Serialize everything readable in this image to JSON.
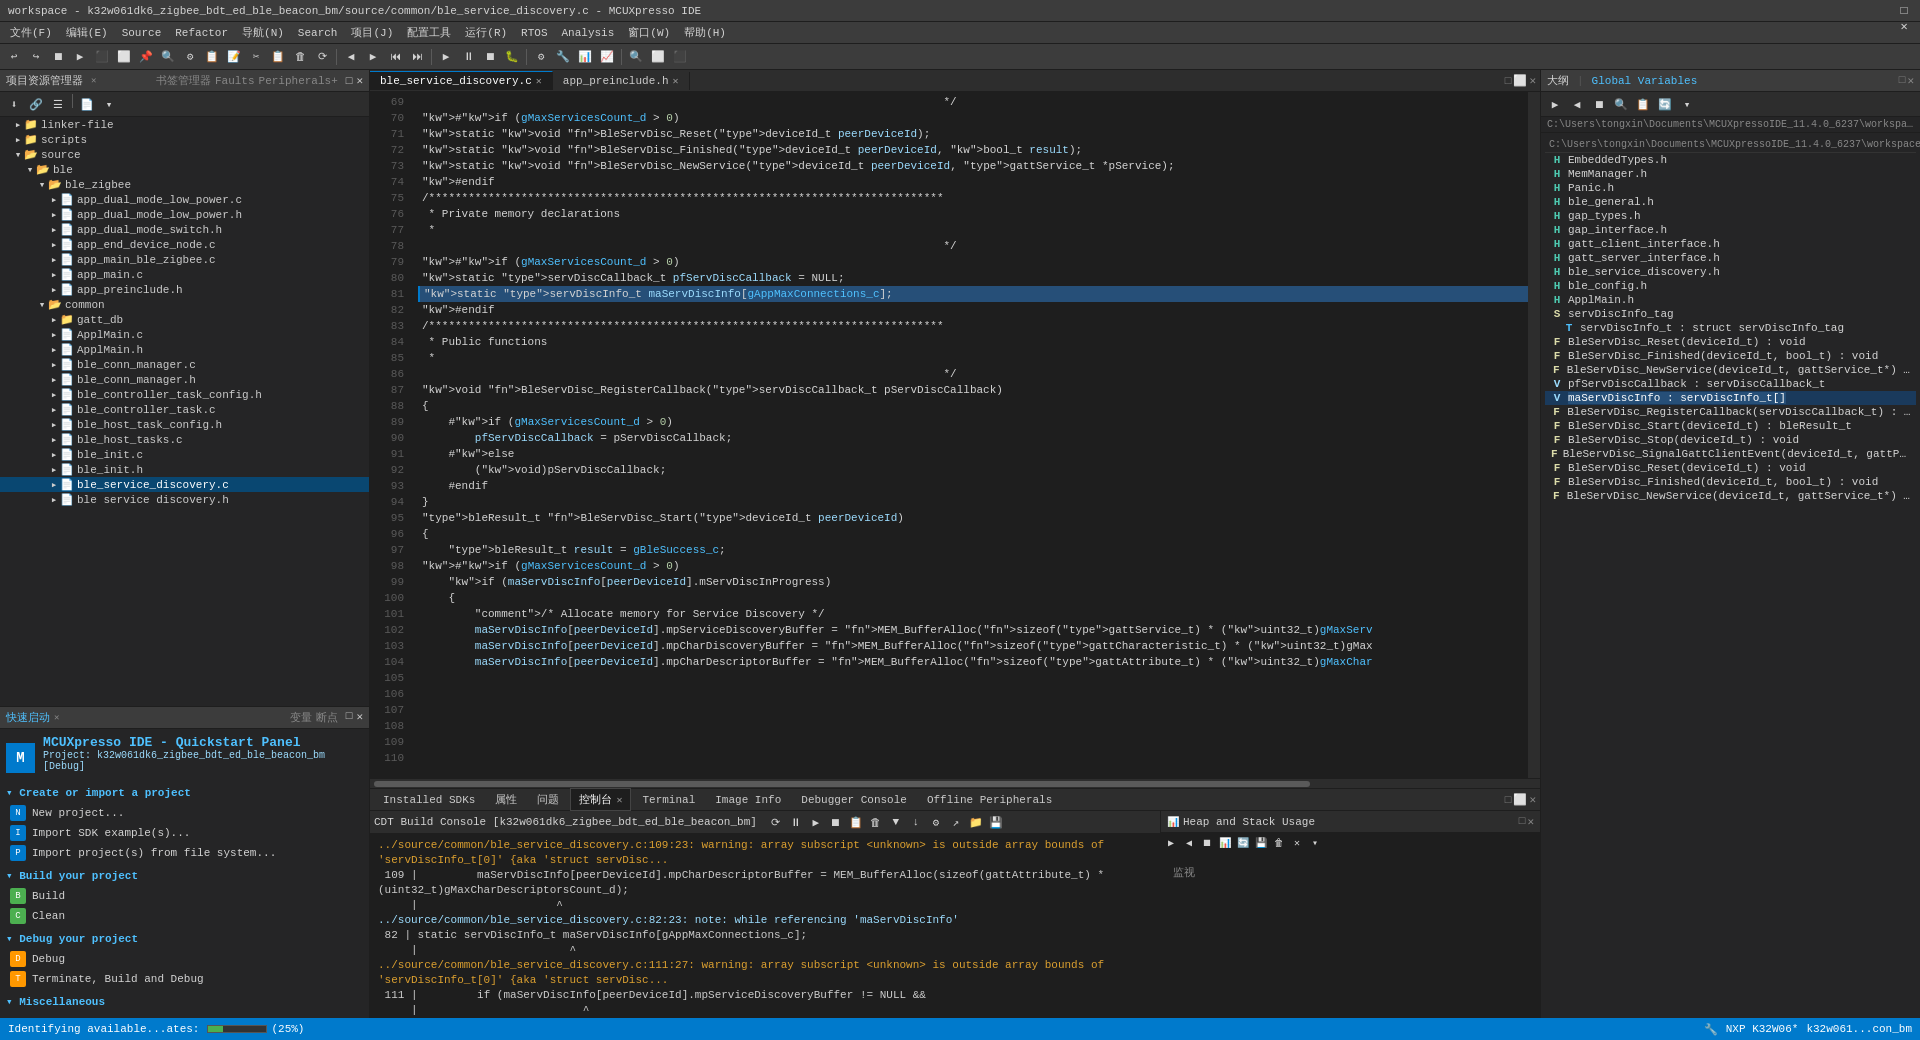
{
  "titleBar": {
    "title": "workspace - k32w061dk6_zigbee_bdt_ed_ble_beacon_bm/source/common/ble_service_discovery.c - MCUXpresso IDE",
    "minimize": "─",
    "maximize": "□",
    "close": "✕"
  },
  "menuBar": {
    "items": [
      "文件(F)",
      "编辑(E)",
      "Source",
      "Refactor",
      "导航(N)",
      "Search",
      "项目(J)",
      "配置工具",
      "运行(R)",
      "RTOS",
      "Analysis",
      "窗口(W)",
      "帮助(H)"
    ]
  },
  "leftPanel": {
    "title": "项目资源管理器",
    "tabs": [
      "书签管理器",
      "Faults",
      "Peripherals+"
    ],
    "tree": [
      {
        "label": "linker-file",
        "indent": 1,
        "expanded": false,
        "icon": "📁"
      },
      {
        "label": "scripts",
        "indent": 1,
        "expanded": false,
        "icon": "📁"
      },
      {
        "label": "source",
        "indent": 1,
        "expanded": true,
        "icon": "📂"
      },
      {
        "label": "ble",
        "indent": 2,
        "expanded": true,
        "icon": "📂"
      },
      {
        "label": "ble_zigbee",
        "indent": 3,
        "expanded": true,
        "icon": "📂"
      },
      {
        "label": "app_dual_mode_low_power.c",
        "indent": 4,
        "expanded": false,
        "icon": "📄"
      },
      {
        "label": "app_dual_mode_low_power.h",
        "indent": 4,
        "expanded": false,
        "icon": "📄"
      },
      {
        "label": "app_dual_mode_switch.h",
        "indent": 4,
        "expanded": false,
        "icon": "📄"
      },
      {
        "label": "app_end_device_node.c",
        "indent": 4,
        "expanded": false,
        "icon": "📄"
      },
      {
        "label": "app_main_ble_zigbee.c",
        "indent": 4,
        "expanded": false,
        "icon": "📄"
      },
      {
        "label": "app_main.c",
        "indent": 4,
        "expanded": false,
        "icon": "📄"
      },
      {
        "label": "app_preinclude.h",
        "indent": 4,
        "expanded": false,
        "icon": "📄"
      },
      {
        "label": "common",
        "indent": 3,
        "expanded": true,
        "icon": "📂"
      },
      {
        "label": "gatt_db",
        "indent": 4,
        "expanded": false,
        "icon": "📁"
      },
      {
        "label": "ApplMain.c",
        "indent": 4,
        "expanded": false,
        "icon": "📄"
      },
      {
        "label": "ApplMain.h",
        "indent": 4,
        "expanded": false,
        "icon": "📄"
      },
      {
        "label": "ble_conn_manager.c",
        "indent": 4,
        "expanded": false,
        "icon": "📄"
      },
      {
        "label": "ble_conn_manager.h",
        "indent": 4,
        "expanded": false,
        "icon": "📄"
      },
      {
        "label": "ble_controller_task_config.h",
        "indent": 4,
        "expanded": false,
        "icon": "📄"
      },
      {
        "label": "ble_controller_task.c",
        "indent": 4,
        "expanded": false,
        "icon": "📄"
      },
      {
        "label": "ble_host_task_config.h",
        "indent": 4,
        "expanded": false,
        "icon": "📄"
      },
      {
        "label": "ble_host_tasks.c",
        "indent": 4,
        "expanded": false,
        "icon": "📄"
      },
      {
        "label": "ble_init.c",
        "indent": 4,
        "expanded": false,
        "icon": "📄"
      },
      {
        "label": "ble_init.h",
        "indent": 4,
        "expanded": false,
        "icon": "📄"
      },
      {
        "label": "ble_service_discovery.c",
        "indent": 4,
        "expanded": false,
        "icon": "📄",
        "selected": true
      },
      {
        "label": "ble service discovery.h",
        "indent": 4,
        "expanded": false,
        "icon": "📄"
      }
    ]
  },
  "quickstartPanel": {
    "header": "快速启动",
    "tabs": [
      "变量",
      "断点"
    ],
    "logoText": "MCUXpresso IDE - Quickstart Panel",
    "projectLabel": "Project: k32w061dk6_zigbee_bdt_ed_ble_beacon_bm [Debug]",
    "sections": [
      {
        "title": "Create or import a project",
        "items": [
          {
            "icon": "N",
            "label": "New project..."
          },
          {
            "icon": "I",
            "label": "Import SDK example(s)..."
          },
          {
            "icon": "P",
            "label": "Import project(s) from file system..."
          }
        ]
      },
      {
        "title": "Build your project",
        "items": [
          {
            "icon": "B",
            "label": "Build"
          },
          {
            "icon": "C",
            "label": "Clean"
          }
        ]
      },
      {
        "title": "Debug your project",
        "items": [
          {
            "icon": "D",
            "label": "Debug"
          },
          {
            "icon": "T",
            "label": "Terminate, Build and Debug"
          }
        ]
      }
    ],
    "miscellaneous": "Miscellaneous"
  },
  "editorTabs": [
    {
      "label": "ble_service_discovery.c",
      "active": true,
      "modified": false
    },
    {
      "label": "app_preinclude.h",
      "active": false,
      "modified": false
    }
  ],
  "editorToolbar": {
    "buttons": [
      "◀",
      "▶",
      "⟳",
      "✕"
    ]
  },
  "codeLines": [
    {
      "num": 69,
      "text": "                                                                               */"
    },
    {
      "num": 70,
      "text": "#if (gMaxServicesCount_d > 0)"
    },
    {
      "num": 71,
      "text": "static void BleServDisc_Reset(deviceId_t peerDeviceId);"
    },
    {
      "num": 72,
      "text": "static void BleServDisc_Finished(deviceId_t peerDeviceId, bool_t result);"
    },
    {
      "num": 73,
      "text": "static void BleServDisc_NewService(deviceId_t peerDeviceId, gattService_t *pService);"
    },
    {
      "num": 74,
      "text": "#endif"
    },
    {
      "num": 75,
      "text": "/******************************************************************************"
    },
    {
      "num": 76,
      "text": ""
    },
    {
      "num": 77,
      "text": " * Private memory declarations"
    },
    {
      "num": 78,
      "text": " *"
    },
    {
      "num": 79,
      "text": "                                                                               */"
    },
    {
      "num": 80,
      "text": "#if (gMaxServicesCount_d > 0)"
    },
    {
      "num": 81,
      "text": "static servDiscCallback_t pfServDiscCallback = NULL;"
    },
    {
      "num": 82,
      "text": "static servDiscInfo_t maServDiscInfo[gAppMaxConnections_c];",
      "selected": true
    },
    {
      "num": 83,
      "text": "#endif"
    },
    {
      "num": 84,
      "text": "/******************************************************************************"
    },
    {
      "num": 85,
      "text": ""
    },
    {
      "num": 86,
      "text": " * Public functions"
    },
    {
      "num": 87,
      "text": " *"
    },
    {
      "num": 88,
      "text": "                                                                               */"
    },
    {
      "num": 89,
      "text": ""
    },
    {
      "num": 90,
      "text": "void BleServDisc_RegisterCallback(servDiscCallback_t pServDiscCallback)"
    },
    {
      "num": 91,
      "text": "{"
    },
    {
      "num": 92,
      "text": "    #if (gMaxServicesCount_d > 0)"
    },
    {
      "num": 93,
      "text": "        pfServDiscCallback = pServDiscCallback;"
    },
    {
      "num": 94,
      "text": "    #else"
    },
    {
      "num": 95,
      "text": "        (void)pServDiscCallback;"
    },
    {
      "num": 96,
      "text": "    #endif"
    },
    {
      "num": 97,
      "text": "}"
    },
    {
      "num": 98,
      "text": ""
    },
    {
      "num": 99,
      "text": "bleResult_t BleServDisc_Start(deviceId_t peerDeviceId)"
    },
    {
      "num": 100,
      "text": "{"
    },
    {
      "num": 101,
      "text": "    bleResult_t result = gBleSuccess_c;"
    },
    {
      "num": 102,
      "text": ""
    },
    {
      "num": 103,
      "text": "#if (gMaxServicesCount_d > 0)"
    },
    {
      "num": 104,
      "text": "    if (maServDiscInfo[peerDeviceId].mServDiscInProgress)"
    },
    {
      "num": 105,
      "text": "    {"
    },
    {
      "num": 106,
      "text": "        /* Allocate memory for Service Discovery */"
    },
    {
      "num": 107,
      "text": ""
    },
    {
      "num": 108,
      "text": "        maServDiscInfo[peerDeviceId].mpServiceDiscoveryBuffer = MEM_BufferAlloc(sizeof(gattService_t) * (uint32_t)gMaxServ"
    },
    {
      "num": 109,
      "text": "        maServDiscInfo[peerDeviceId].mpCharDiscoveryBuffer = MEM_BufferAlloc(sizeof(gattCharacteristic_t) * (uint32_t)gMax"
    },
    {
      "num": 110,
      "text": "        maServDiscInfo[peerDeviceId].mpCharDescriptorBuffer = MEM_BufferAlloc(sizeof(gattAttribute_t) * (uint32_t)gMaxChar"
    }
  ],
  "rightPanel": {
    "title": "大纲",
    "tabs": [
      "Global Variables"
    ],
    "path": "C:\\Users\\tongxin\\Documents\\MCUXpressoIDE_11.4.0_6237\\workspace\\k32w06...",
    "items": [
      {
        "label": "EmbeddedTypes.h",
        "indent": 0,
        "icon": "H"
      },
      {
        "label": "MemManager.h",
        "indent": 0,
        "icon": "H"
      },
      {
        "label": "Panic.h",
        "indent": 0,
        "icon": "H"
      },
      {
        "label": "ble_general.h",
        "indent": 0,
        "icon": "H"
      },
      {
        "label": "gap_types.h",
        "indent": 0,
        "icon": "H"
      },
      {
        "label": "gap_interface.h",
        "indent": 0,
        "icon": "H"
      },
      {
        "label": "gatt_client_interface.h",
        "indent": 0,
        "icon": "H"
      },
      {
        "label": "gatt_server_interface.h",
        "indent": 0,
        "icon": "H"
      },
      {
        "label": "ble_service_discovery.h",
        "indent": 0,
        "icon": "H"
      },
      {
        "label": "ble_config.h",
        "indent": 0,
        "icon": "H"
      },
      {
        "label": "ApplMain.h",
        "indent": 0,
        "icon": "H"
      },
      {
        "label": "servDiscInfo_tag",
        "indent": 0,
        "icon": "S",
        "expanded": true
      },
      {
        "label": "servDiscInfo_t : struct servDiscInfo_tag",
        "indent": 1,
        "icon": "T"
      },
      {
        "label": "BleServDisc_Reset(deviceId_t) : void",
        "indent": 0,
        "icon": "F"
      },
      {
        "label": "BleServDisc_Finished(deviceId_t, bool_t) : void",
        "indent": 0,
        "icon": "F"
      },
      {
        "label": "BleServDisc_NewService(deviceId_t, gattService_t*) : void",
        "indent": 0,
        "icon": "F"
      },
      {
        "label": "pfServDiscCallback : servDiscCallback_t",
        "indent": 0,
        "icon": "V"
      },
      {
        "label": "maServDiscInfo : servDiscInfo_t[]",
        "indent": 0,
        "icon": "V",
        "selected": true,
        "highlighted": true
      },
      {
        "label": "BleServDisc_RegisterCallback(servDiscCallback_t) : void",
        "indent": 0,
        "icon": "F"
      },
      {
        "label": "BleServDisc_Start(deviceId_t) : bleResult_t",
        "indent": 0,
        "icon": "F"
      },
      {
        "label": "BleServDisc_Stop(deviceId_t) : void",
        "indent": 0,
        "icon": "F"
      },
      {
        "label": "BleServDisc_SignalGattClientEvent(deviceId_t, gattProcedureType_t, gattProce...",
        "indent": 0,
        "icon": "F"
      },
      {
        "label": "BleServDisc_Reset(deviceId_t) : void",
        "indent": 0,
        "icon": "F"
      },
      {
        "label": "BleServDisc_Finished(deviceId_t, bool_t) : void",
        "indent": 0,
        "icon": "F"
      },
      {
        "label": "BleServDisc_NewService(deviceId_t, gattService_t*) : void",
        "indent": 0,
        "icon": "F"
      }
    ]
  },
  "bottomPanel": {
    "tabs": [
      {
        "label": "Installed SDKs",
        "active": false
      },
      {
        "label": "属性",
        "active": false
      },
      {
        "label": "问题",
        "active": false
      },
      {
        "label": "控制台",
        "active": true
      },
      {
        "label": "Terminal",
        "active": false
      },
      {
        "label": "Image Info",
        "active": false
      },
      {
        "label": "Debugger Console",
        "active": false
      },
      {
        "label": "Offline Peripherals",
        "active": false
      }
    ],
    "consoleTitle": "CDT Build Console [k32w061dk6_zigbee_bdt_ed_ble_beacon_bm]",
    "consoleLines": [
      {
        "type": "warning",
        "text": "../source/common/ble_service_discovery.c:109:23: warning: array subscript <unknown> is outside array bounds of 'servDiscInfo_t[0]' {aka 'struct servDisc..."
      },
      {
        "type": "normal",
        "text": " 109 |         maServDiscInfo[peerDeviceId].mpCharDescriptorBuffer = MEM_BufferAlloc(sizeof(gattAttribute_t) * (uint32_t)gMaxCharDescriptorsCount_d);"
      },
      {
        "type": "normal",
        "text": "     |                     ^"
      },
      {
        "type": "normal",
        "text": ""
      },
      {
        "type": "note",
        "text": "../source/common/ble_service_discovery.c:82:23: note: while referencing 'maServDiscInfo'"
      },
      {
        "type": "normal",
        "text": " 82 | static servDiscInfo_t maServDiscInfo[gAppMaxConnections_c];"
      },
      {
        "type": "normal",
        "text": "     |                       ^"
      },
      {
        "type": "normal",
        "text": ""
      },
      {
        "type": "warning",
        "text": "../source/common/ble_service_discovery.c:111:27: warning: array subscript <unknown> is outside array bounds of 'servDiscInfo_t[0]' {aka 'struct servDisc..."
      },
      {
        "type": "normal",
        "text": " 111 |         if (maServDiscInfo[peerDeviceId].mpServiceDiscoveryBuffer != NULL &&"
      },
      {
        "type": "normal",
        "text": "     |                         ^"
      },
      {
        "type": "normal",
        "text": ""
      },
      {
        "type": "note",
        "text": "../source/common/ble_service_discovery.c:82:23: note: while referencing 'maServDiscInfo'"
      },
      {
        "type": "normal",
        "text": " 82 | static servDiscInfo_t maServDiscInfo[gAppMaxConnections_c];"
      },
      {
        "type": "normal",
        "text": "     |                       ^"
      }
    ]
  },
  "heapStack": {
    "title": "Heap and Stack Usage"
  },
  "statusBar": {
    "left": "Identifying available...ates:",
    "progress": 25,
    "progressLabel": "(25%)",
    "right1": "NXP K32W06*",
    "right2": "k32w061...con_bm"
  }
}
